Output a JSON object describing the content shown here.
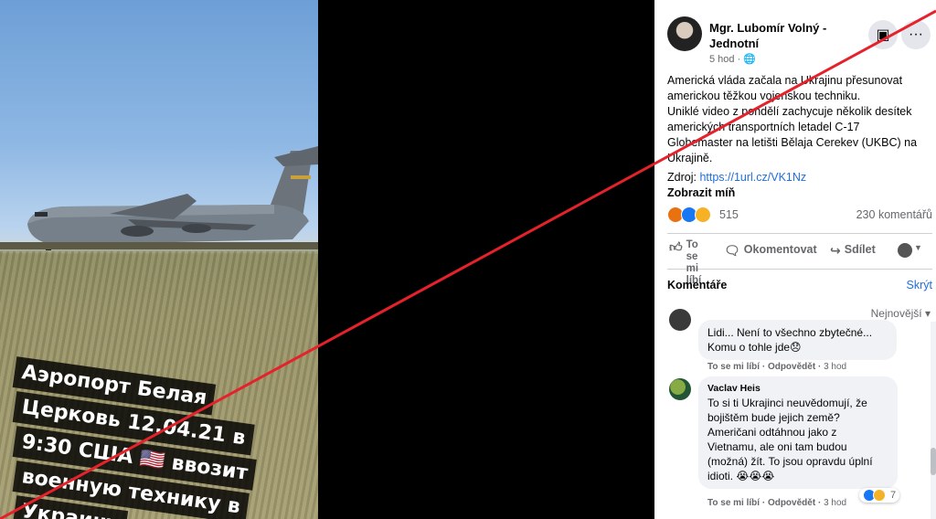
{
  "video": {
    "caption_lines": [
      "Аэропорт Белая",
      "Церковь 12.04.21 в",
      "9:30 США 🇺🇸 ввозит",
      "военную технику в",
      "Украину"
    ]
  },
  "post": {
    "author": "Mgr. Lubomír Volný - Jednotní",
    "time": "5 hod · 🌐",
    "text_lines": [
      "Americká vláda začala na Ukrajinu přesunovat americkou těžkou vojenskou techniku.",
      "Uniklé video z pondělí zachycuje několik desítek amerických transportních letadel C-17 Globemaster na letišti Bělaja Cerekev (UKBC) na Ukrajině."
    ],
    "source_label": "Zdroj:",
    "source_link": "https://1url.cz/VK1Nz",
    "see_more": "Zobrazit míň",
    "reaction_count": "515",
    "comment_count": "230 komentářů",
    "actions": {
      "like": "To se mi líbí",
      "comment": "Okomentovat",
      "share": "Sdílet"
    },
    "more_icon": "···"
  },
  "comments_section": {
    "title": "Komentáře",
    "hide": "Skrýt",
    "sort": "Nejnovější ▾"
  },
  "comments": [
    {
      "text_line1": "Lidi... Není to všechno zbytečné...",
      "text_line2": "Komu o tohle jde😞",
      "like": "To se mi líbí",
      "reply": "Odpovědět",
      "time": "3 hod"
    },
    {
      "name": "Vaclav Heis",
      "text": "To si ti Ukrajinci neuvědomují, že bojištěm bude jejich země? Američani odtáhnou jako z Vietnamu, ale oni tam budou (možná) žít. To jsou opravdu úplní idioti. 😭😭😭",
      "like": "To se mi líbí",
      "reply": "Odpovědět",
      "time": "3 hod",
      "reactions": "7"
    }
  ],
  "colors": {
    "link": "#216fdb",
    "cross": "#e5222b",
    "panel": "#ffffff"
  }
}
